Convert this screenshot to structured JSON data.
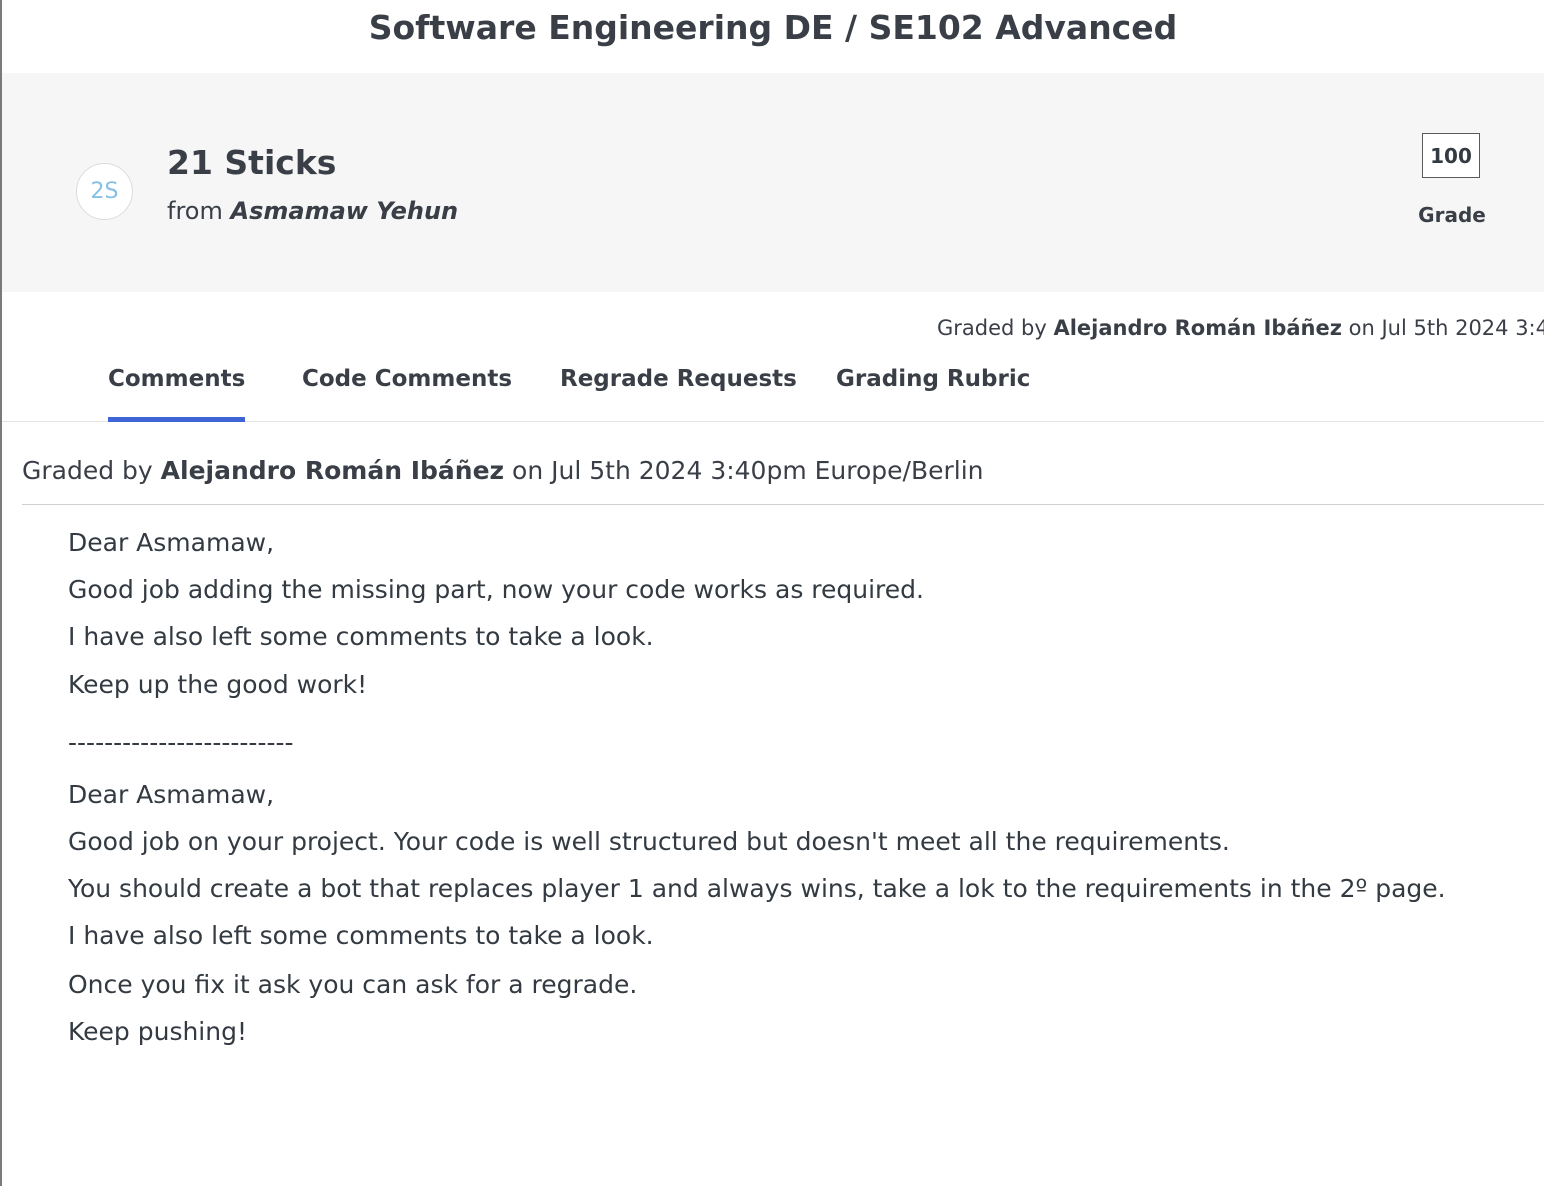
{
  "header": {
    "course_title": "Software Engineering DE / SE102 Advanced"
  },
  "submission": {
    "avatar_initials": "2S",
    "assignment_title": "21 Sticks",
    "from_prefix": "from",
    "student_name": "Asmamaw Yehun",
    "grade_value": "100",
    "grade_label": "Grade"
  },
  "graded_summary": {
    "prefix": "Graded by",
    "grader": "Alejandro Román Ibáñez",
    "date_text": "on Jul 5th 2024 3:40pm"
  },
  "tabs": [
    {
      "label": "Comments",
      "active": true
    },
    {
      "label": "Code Comments",
      "active": false
    },
    {
      "label": "Regrade Requests",
      "active": false
    },
    {
      "label": "Grading Rubric",
      "active": false
    }
  ],
  "comment": {
    "prefix": "Graded by",
    "grader": "Alejandro Román Ibáñez",
    "date_text": "on Jul 5th 2024 3:40pm Europe/Berlin",
    "lines": [
      "Dear Asmamaw,",
      "Good job adding the missing part, now your code works as required.",
      "I have also left some comments to take a look.",
      "Keep up the good work!",
      "-------------------------",
      "Dear Asmamaw,",
      "Good job on your project. Your code is well structured but doesn't meet all the requirements.",
      "You should create a bot that replaces player 1 and always wins, take a lok to the requirements in the 2º page.",
      "I have also left some comments to take a look.",
      "Once you fix it ask you can ask for a regrade.",
      "Keep pushing!"
    ]
  },
  "colors": {
    "active_tab_underline": "#3e64d6",
    "avatar_text": "#86c0e8",
    "header_panel_bg": "#f6f6f6"
  }
}
